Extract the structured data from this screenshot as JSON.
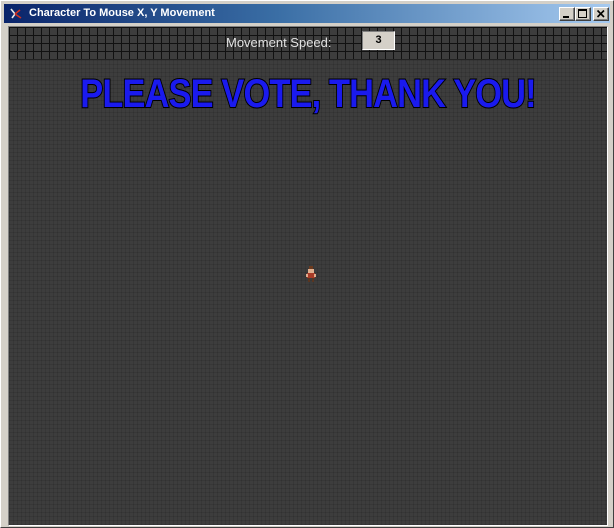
{
  "window": {
    "title": "Character To Mouse X, Y Movement",
    "icon": "app-icon",
    "controls": [
      "minimize-icon",
      "maximize-icon",
      "close-icon"
    ]
  },
  "toolbar": {
    "speed_label": "Movement Speed:",
    "speed_value": "3"
  },
  "game": {
    "banner": "PLEASE VOTE, THANK YOU!",
    "character": "character-sprite"
  },
  "colors": {
    "banner_fill": "#1a1aee",
    "background": "#3d3d3d",
    "titlebar_start": "#0a246a",
    "titlebar_end": "#a6caf0"
  }
}
